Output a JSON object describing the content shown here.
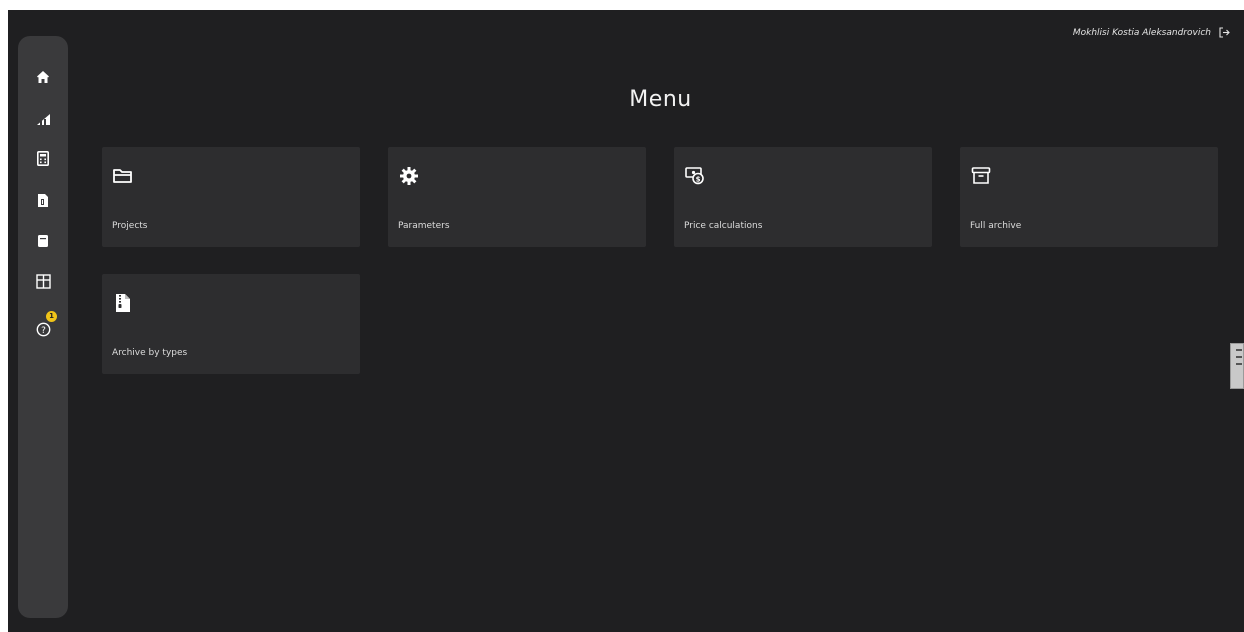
{
  "header": {
    "user_name": "Mokhlisi Kostia Aleksandrovich",
    "logout_icon": "logout-icon"
  },
  "sidebar": {
    "items": [
      {
        "id": "home",
        "icon": "home-icon"
      },
      {
        "id": "chart",
        "icon": "bar-chart-icon"
      },
      {
        "id": "calculator",
        "icon": "calculator-icon"
      },
      {
        "id": "document",
        "icon": "document-icon"
      },
      {
        "id": "archive",
        "icon": "archive-icon"
      },
      {
        "id": "map",
        "icon": "map-icon"
      },
      {
        "id": "help",
        "icon": "help-icon",
        "badge": "1"
      }
    ]
  },
  "main": {
    "title": "Menu",
    "cards": [
      {
        "label": "Projects",
        "icon": "folder-icon"
      },
      {
        "label": "Parameters",
        "icon": "gear-icon"
      },
      {
        "label": "Price calculations",
        "icon": "money-icon"
      },
      {
        "label": "Full archive",
        "icon": "archive-box-icon"
      },
      {
        "label": "Archive by types",
        "icon": "file-archive-icon"
      }
    ]
  },
  "colors": {
    "background": "#1f1f21",
    "sidebar": "#3a3a3c",
    "card": "#2d2d2f",
    "badge": "#f0c419",
    "text": "#f2f2f2"
  }
}
